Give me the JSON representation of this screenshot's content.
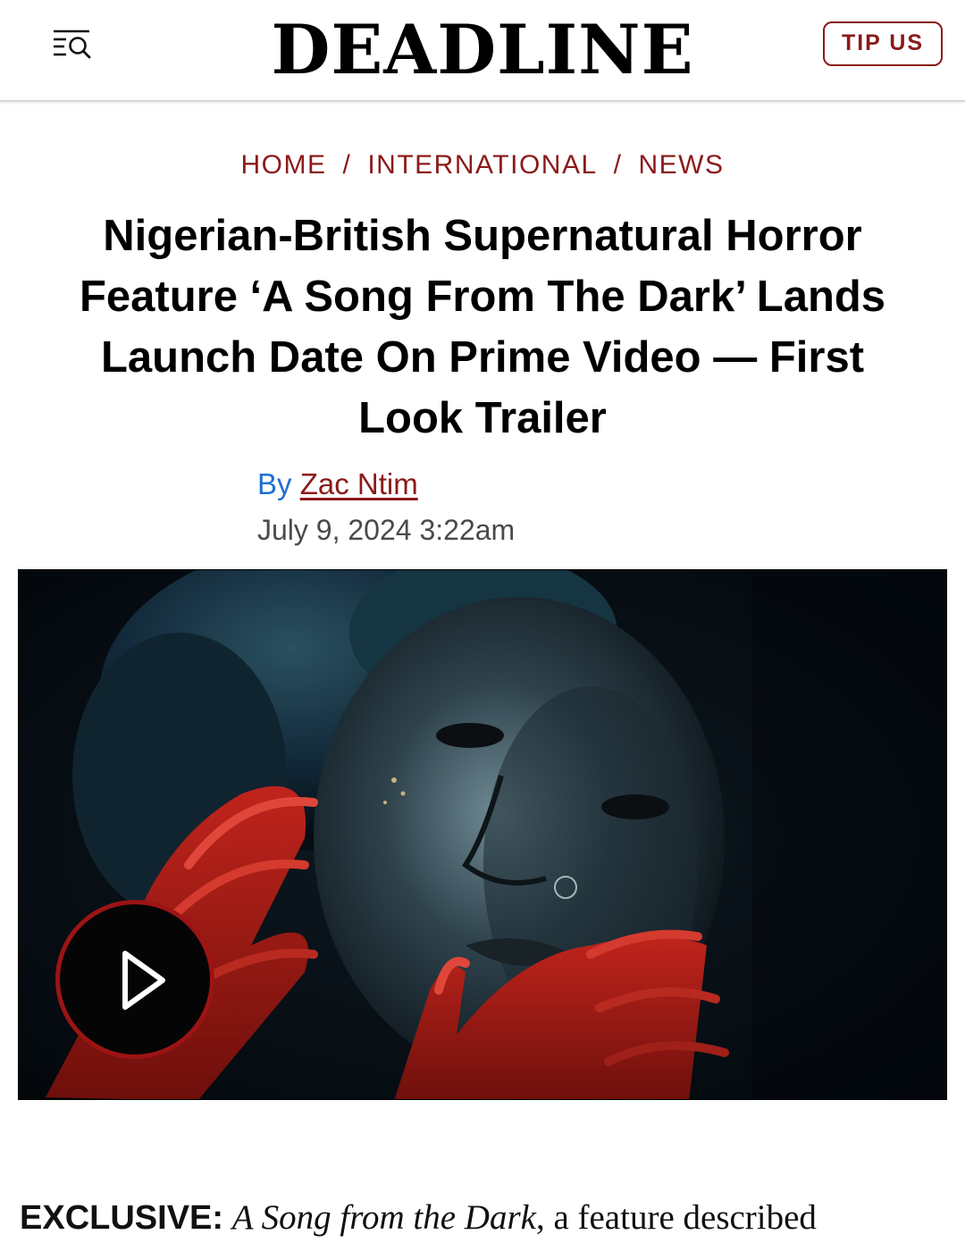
{
  "header": {
    "logo": "DEADLINE",
    "menu_icon": "menu-search-icon",
    "tip_label": "TIP US"
  },
  "breadcrumb": {
    "items": [
      "HOME",
      "INTERNATIONAL",
      "NEWS"
    ],
    "separator": "/"
  },
  "article": {
    "headline_lines": [
      "Nigerian-British Supernatural Horror",
      "Feature ‘A Song From The Dark’ Lands",
      "Launch Date On Prime Video — First",
      "Look Trailer"
    ],
    "byline_prefix": "By",
    "author": "Zac Ntim",
    "date": "July 9, 2024 3:22am",
    "lede_tag": "EXCLUSIVE:",
    "lede_title": "A Song from the Dark",
    "lede_rest": ", a feature described"
  },
  "video": {
    "play_icon": "play-icon"
  },
  "colors": {
    "brand_red": "#8b1a1a",
    "byline_blue": "#1f6fd1",
    "play_ring": "#9c1414"
  }
}
